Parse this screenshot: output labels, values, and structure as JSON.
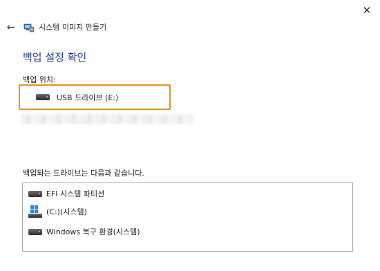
{
  "window": {
    "title": "시스템 이미지 만들기",
    "close_glyph": "✕",
    "back_glyph": "←"
  },
  "heading": "백업 설정 확인",
  "backup_location": {
    "label": "백업 위치:",
    "value": "USB 드라이브 (E:)",
    "highlight_color": "#e6901a"
  },
  "drives": {
    "label": "백업되는 드라이브는 다음과 같습니다.",
    "items": [
      {
        "label": "EFI 시스템 파티션",
        "icon": "drive-icon"
      },
      {
        "label": "(C:)(시스템)",
        "icon": "windows-drive-icon"
      },
      {
        "label": "Windows 복구 환경(시스템)",
        "icon": "drive-icon"
      }
    ]
  },
  "colors": {
    "heading": "#1f3d8a",
    "windows_blue": "#1e88e5"
  }
}
